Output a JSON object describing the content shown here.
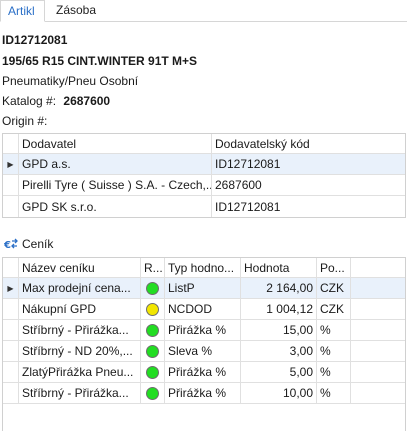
{
  "tabs": [
    {
      "label": "Artikl"
    },
    {
      "label": "Zásoba"
    }
  ],
  "article": {
    "code": "ID12712081",
    "name": "195/65 R15 CINT.WINTER 91T M+S",
    "category": "Pneumatiky/Pneu Osobní",
    "catalog_label": "Katalog #:",
    "catalog_value": "2687600",
    "origin_label": "Origin #:"
  },
  "suppliers": {
    "headers": [
      "Dodavatel",
      "Dodavatelský kód"
    ],
    "rows": [
      {
        "name": "GPD a.s.",
        "code": "ID12712081"
      },
      {
        "name": "Pirelli Tyre ( Suisse ) S.A. - Czech,...",
        "code": "2687600"
      },
      {
        "name": "GPD SK s.r.o.",
        "code": "ID12712081"
      }
    ]
  },
  "pricelist": {
    "title": "Ceník",
    "headers": [
      "Název ceníku",
      "R...",
      "Typ hodno...",
      "Hodnota",
      "Po..."
    ],
    "rows": [
      {
        "name": "Max prodejní cena...",
        "status": "green",
        "type": "ListP",
        "value": "2 164,00",
        "unit": "CZK"
      },
      {
        "name": "Nákupní GPD",
        "status": "yellow",
        "type": "NCDOD",
        "value": "1 004,12",
        "unit": "CZK"
      },
      {
        "name": "Stříbrný - Přirážka...",
        "status": "green",
        "type": "Přirážka %",
        "value": "15,00",
        "unit": "%"
      },
      {
        "name": "Stříbrný - ND 20%,...",
        "status": "green",
        "type": "Sleva %",
        "value": "3,00",
        "unit": "%"
      },
      {
        "name": "ZlatýPřirážka Pneu...",
        "status": "green",
        "type": "Přirážka %",
        "value": "5,00",
        "unit": "%"
      },
      {
        "name": "Stříbrný - Přirážka...",
        "status": "green",
        "type": "Přirážka %",
        "value": "10,00",
        "unit": "%"
      }
    ]
  },
  "colors": {
    "accent": "#2a6fc7",
    "selected_row": "#e9f1fb",
    "status_green": "#22dd22",
    "status_yellow": "#f2e600"
  }
}
